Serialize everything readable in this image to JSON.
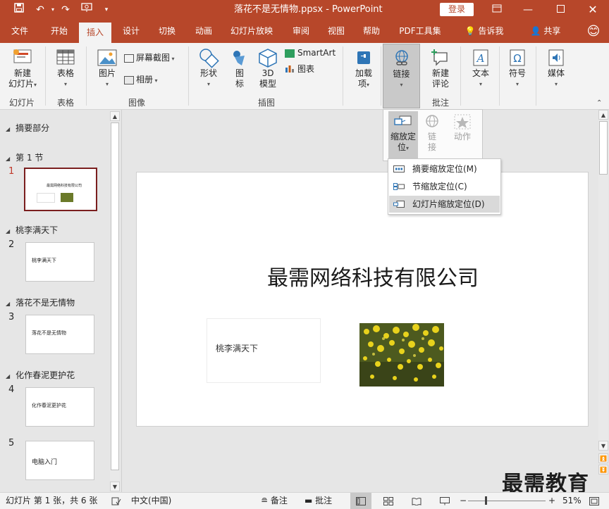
{
  "window": {
    "title": "落花不是无情物.ppsx  -  PowerPoint",
    "login_label": "登录"
  },
  "tabs": [
    "文件",
    "开始",
    "插入",
    "设计",
    "切换",
    "动画",
    "幻灯片放映",
    "审阅",
    "视图",
    "帮助",
    "PDF工具集"
  ],
  "active_tab": "插入",
  "tell_me": "告诉我",
  "share": "共享",
  "ribbon": {
    "new_slide": [
      "新建",
      "幻灯片"
    ],
    "group_slides": "幻灯片",
    "table": "表格",
    "group_table": "表格",
    "picture": "图片",
    "screenshot": "屏幕截图",
    "album": "相册",
    "group_images": "图像",
    "shapes": "形状",
    "icons": [
      "图",
      "标"
    ],
    "model3d": [
      "3D",
      "模型"
    ],
    "smartart": "SmartArt",
    "chart": "图表",
    "group_illustrations": "插图",
    "addins": [
      "加载",
      "项"
    ],
    "link": "链接",
    "new_comment": [
      "新建",
      "评论"
    ],
    "group_comments": "批注",
    "text": "文本",
    "symbol": "符号",
    "media": "媒体"
  },
  "link_panel": {
    "zoom": [
      "缩放定",
      "位"
    ],
    "link": [
      "链",
      "接"
    ],
    "action": "动作"
  },
  "zoom_menu": [
    {
      "label": "摘要缩放定位(M)",
      "highlighted": false
    },
    {
      "label": "节缩放定位(C)",
      "highlighted": false
    },
    {
      "label": "幻灯片缩放定位(D)",
      "highlighted": true
    }
  ],
  "outline": {
    "summary_section": "摘要部分",
    "sections": [
      {
        "name": "第 1 节",
        "slide_num": "1",
        "thumb_text": "最需网络科技有限公司"
      },
      {
        "name": "桃李满天下",
        "slide_num": "2",
        "thumb_text": "桃李满天下"
      },
      {
        "name": "落花不是无情物",
        "slide_num": "3",
        "thumb_text": "落花不是无情物"
      },
      {
        "name": "化作春泥更护花",
        "slide_num": "4",
        "thumb_text": "化作春泥更护花"
      },
      {
        "name": "",
        "slide_num": "5",
        "thumb_text": "电脑入门"
      }
    ]
  },
  "slide": {
    "title": "最需网络科技有限公司",
    "zoom_box_text": "桃李满天下"
  },
  "status": {
    "slide_info": "幻灯片 第 1 张，共 6 张",
    "language": "中文(中国)",
    "notes": "备注",
    "comments": "批注",
    "zoom": "51%",
    "zoom_level": 0.51
  },
  "watermark": "最需教育",
  "colors": {
    "accent": "#b7472a",
    "selected_thumb_border": "#7a1e1e"
  }
}
